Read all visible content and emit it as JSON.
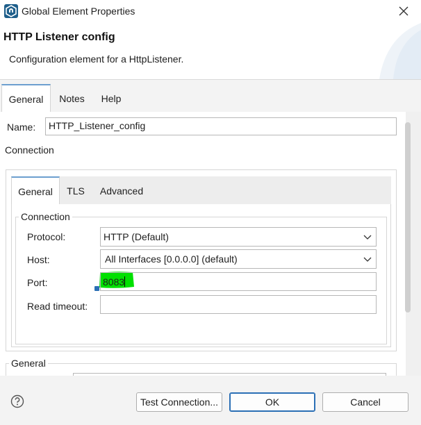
{
  "window": {
    "title": "Global Element Properties",
    "close_icon": "close-icon",
    "app_icon": "mule-app-icon"
  },
  "header": {
    "title": "HTTP Listener config",
    "description": "Configuration element for a HttpListener."
  },
  "main_tabs": [
    {
      "label": "General",
      "active": true
    },
    {
      "label": "Notes",
      "active": false
    },
    {
      "label": "Help",
      "active": false
    }
  ],
  "general": {
    "name_label": "Name:",
    "name_value": "HTTP_Listener_config",
    "connection_heading": "Connection",
    "inner_tabs": [
      {
        "label": "General",
        "active": true
      },
      {
        "label": "TLS",
        "active": false
      },
      {
        "label": "Advanced",
        "active": false
      }
    ],
    "connection_group_label": "Connection",
    "protocol_label": "Protocol:",
    "protocol_value": "HTTP (Default)",
    "host_label": "Host:",
    "host_value": "All Interfaces [0.0.0.0] (default)",
    "port_label": "Port:",
    "port_value": "8083",
    "read_timeout_label": "Read timeout:",
    "read_timeout_value": "",
    "general_group_label": "General"
  },
  "buttons": {
    "help_icon": "help-question-icon",
    "test_connection": "Test Connection...",
    "ok": "OK",
    "cancel": "Cancel"
  },
  "colors": {
    "tab_accent": "#6c9fcf",
    "highlight": "#00e000",
    "default_button_border": "#2a6fb5"
  }
}
